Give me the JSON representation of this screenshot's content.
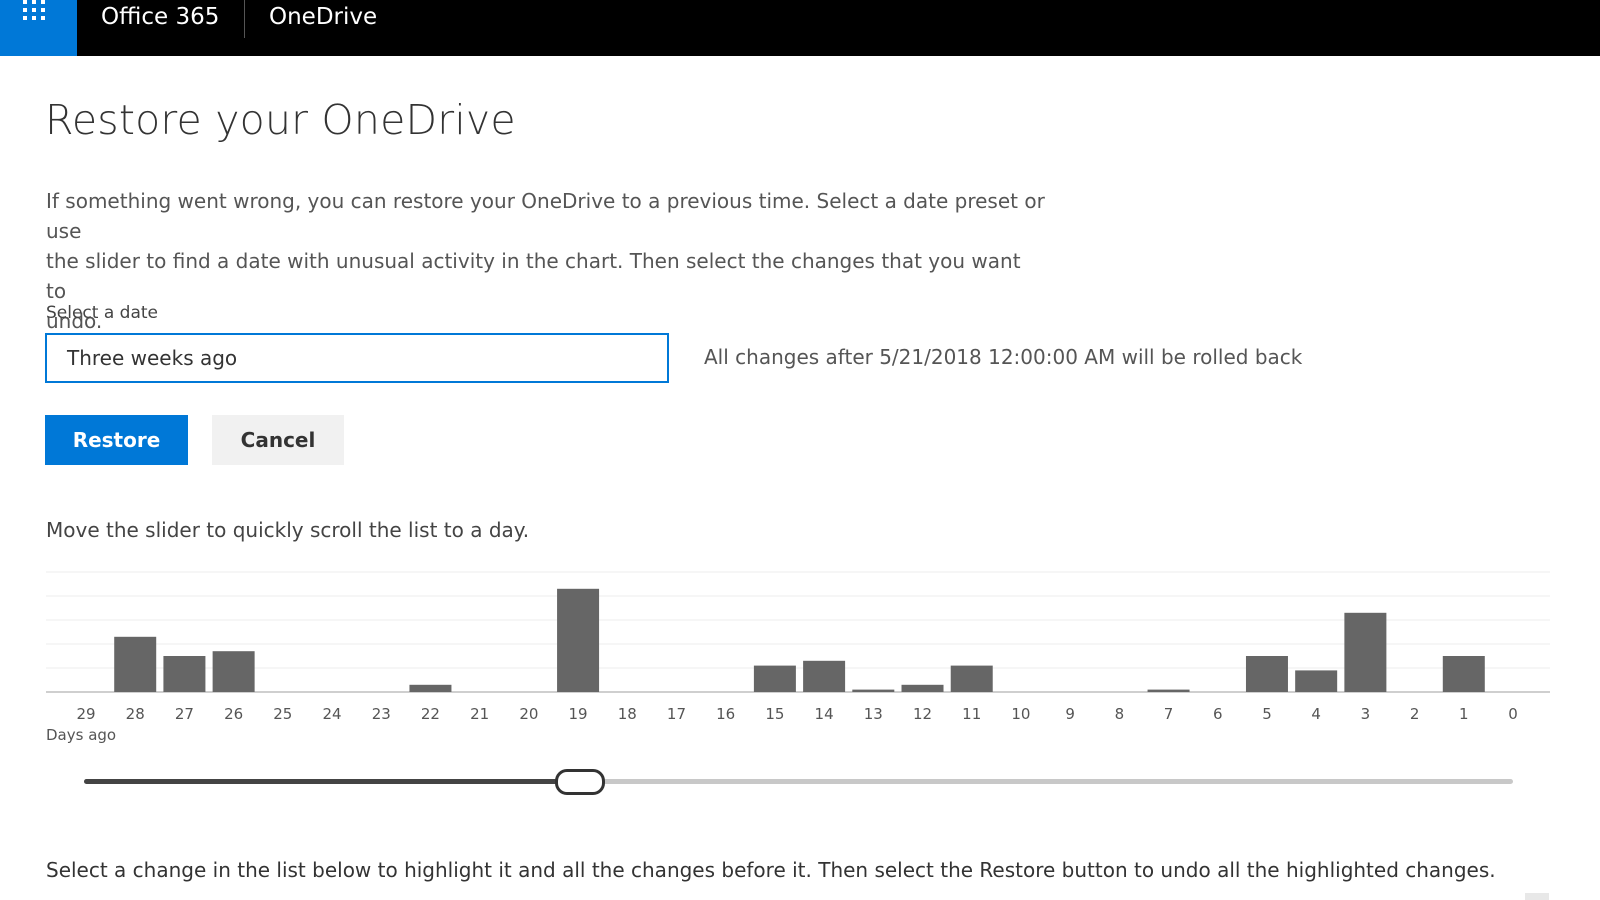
{
  "header": {
    "brand": "Office 365",
    "app": "OneDrive",
    "accent": "#0078d7"
  },
  "page": {
    "title": "Restore your OneDrive",
    "intro_lines": [
      "If something went wrong, you can restore your OneDrive to a previous time. Select a date preset or use",
      "the slider to find a date with unusual activity in the chart. Then select the changes that you want to",
      "undo."
    ]
  },
  "date_picker": {
    "label": "Select a date",
    "value": "Three weeks ago",
    "note": "All changes after 5/21/2018 12:00:00 AM will be rolled back"
  },
  "buttons": {
    "restore": "Restore",
    "cancel": "Cancel"
  },
  "slider_hint": "Move the slider to quickly scroll the list to a day.",
  "chart_data": {
    "type": "bar",
    "xlabel": "Days ago",
    "categories": [
      "29",
      "28",
      "27",
      "26",
      "25",
      "24",
      "23",
      "22",
      "21",
      "20",
      "19",
      "18",
      "17",
      "16",
      "15",
      "14",
      "13",
      "12",
      "11",
      "10",
      "9",
      "8",
      "7",
      "6",
      "5",
      "4",
      "3",
      "2",
      "1",
      "0"
    ],
    "values": [
      0,
      23,
      15,
      17,
      0,
      0,
      0,
      3,
      0,
      0,
      43,
      0,
      0,
      0,
      11,
      13,
      1,
      3,
      11,
      0,
      0,
      0,
      1,
      0,
      15,
      9,
      33,
      0,
      15,
      0
    ],
    "ylim": [
      0,
      50
    ],
    "grid": true,
    "bar_color": "#666666"
  },
  "slider": {
    "selected_day": 19
  },
  "bottom_instructions": "Select a change in the list below to highlight it and all the changes before it. Then select the Restore button to undo all the highlighted changes."
}
